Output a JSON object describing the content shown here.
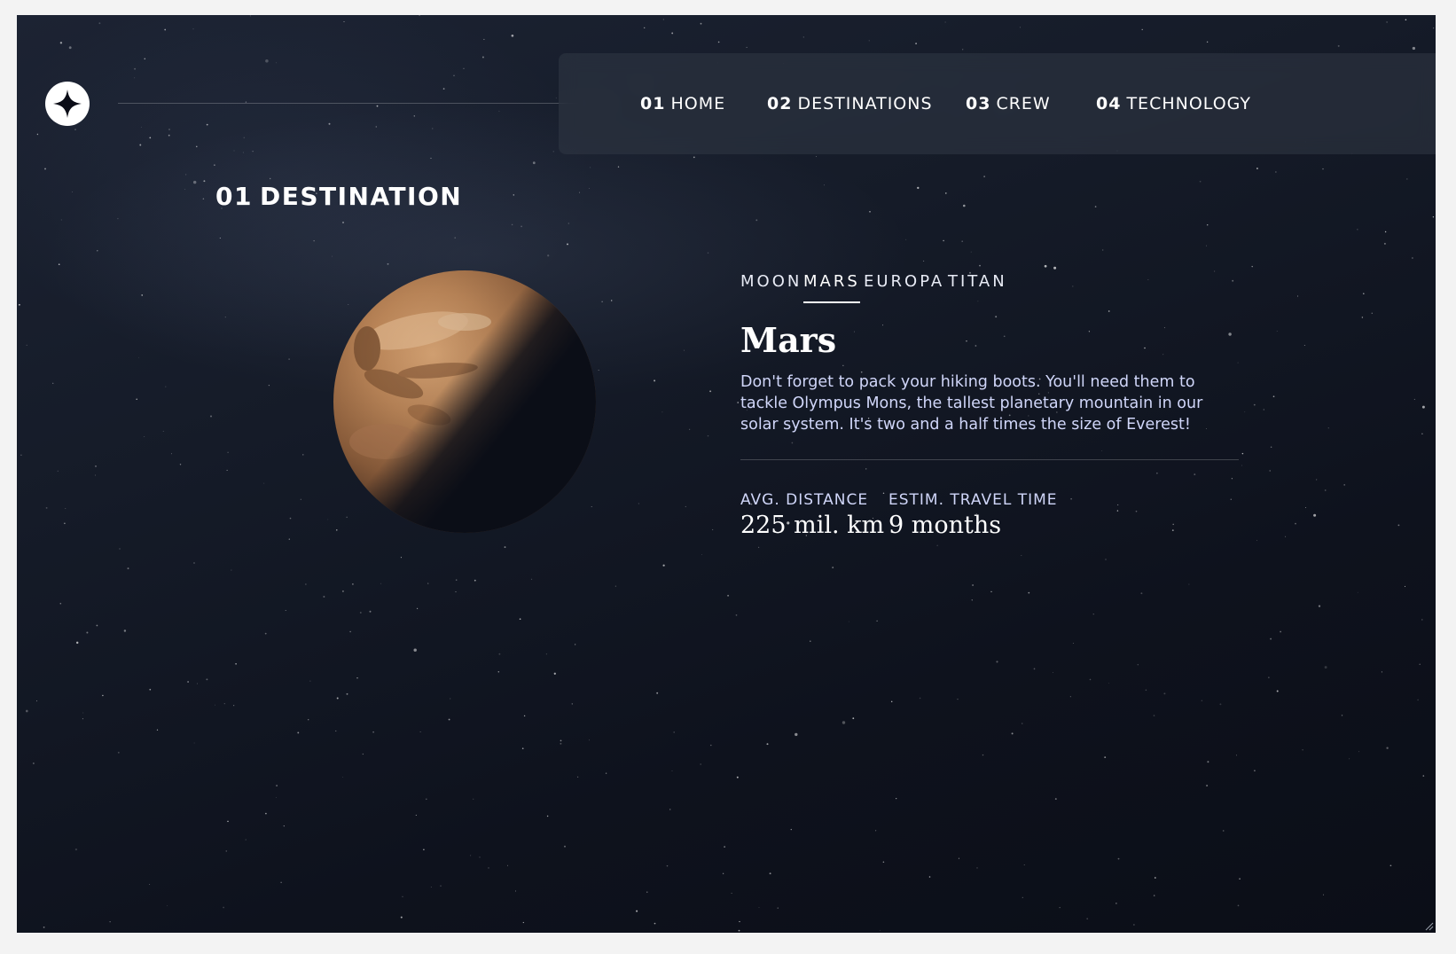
{
  "logo": {
    "icon": "star-logo-icon"
  },
  "nav": {
    "items": [
      {
        "num": "01",
        "label": "HOME"
      },
      {
        "num": "02",
        "label": "DESTINATIONS"
      },
      {
        "num": "03",
        "label": "CREW"
      },
      {
        "num": "04",
        "label": "TECHNOLOGY"
      }
    ]
  },
  "page": {
    "title_num": "01",
    "title": "DESTINATION"
  },
  "destination": {
    "tabs": [
      "MOON",
      "MARS",
      "EUROPA",
      "TITAN"
    ],
    "active_tab": "MARS",
    "name": "Mars",
    "description": "Don't forget to pack your hiking boots. You'll need them to tackle Olympus Mons, the tallest planetary mountain in our solar system. It's two and a half times the size of Everest!",
    "stats": [
      {
        "label": "AVG. DISTANCE",
        "value": "225 mil. km"
      },
      {
        "label": "ESTIM. TRAVEL TIME",
        "value": "9 months"
      }
    ]
  },
  "colors": {
    "background": "#0b0e17",
    "accent_text": "#d0d6f9",
    "white": "#ffffff",
    "planet": "#c1865a"
  }
}
